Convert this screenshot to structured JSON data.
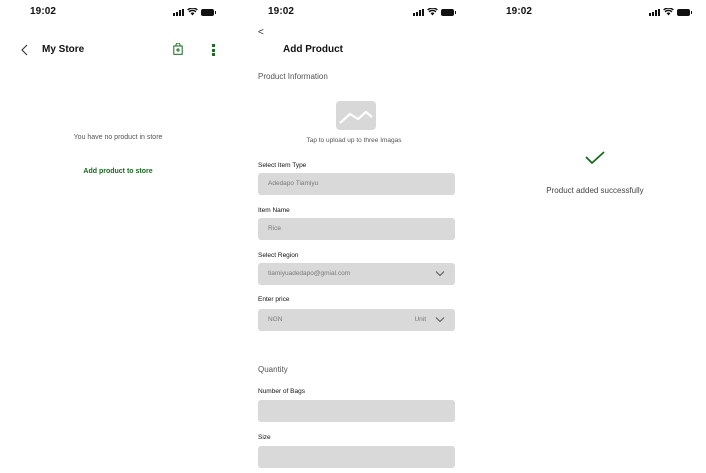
{
  "colors": {
    "accent": "#166a1d",
    "field_bg": "#d9d9d9",
    "placeholder_bg": "#d8d8d8"
  },
  "screen1": {
    "time": "19:02",
    "title": "My Store",
    "icons": [
      "chevron-left-icon",
      "shopping-bag-icon",
      "more-vertical-icon"
    ],
    "empty_message": "You have no product in store",
    "add_product_link": "Add product to store"
  },
  "screen2": {
    "time": "19:02",
    "back": "<",
    "title": "Add Product",
    "product_info_heading": "Product Information",
    "upload_hint": "Tap to upload up to three Imagas",
    "fields": {
      "item_type": {
        "label": "Select Item Type",
        "value": "Adedapo Tiamiyu"
      },
      "item_name": {
        "label": "Item Name",
        "value": "Rice"
      },
      "region": {
        "label": "Select Region",
        "value": "tiamiyuadedapo@gmial.com"
      },
      "price": {
        "label": "Enter price",
        "value": "NGN",
        "unit": "Unit"
      }
    },
    "quantity_heading": "Quantity",
    "bags": {
      "label": "Number of Bags",
      "value": ""
    },
    "size": {
      "label": "Size",
      "value": ""
    }
  },
  "screen3": {
    "time": "19:02",
    "success_message": "Product added successfully"
  }
}
